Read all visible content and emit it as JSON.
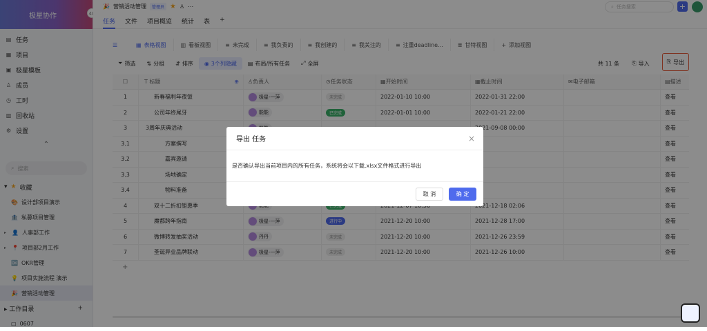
{
  "app": {
    "brand": "极星协作"
  },
  "sidebar": {
    "items": [
      {
        "label": "任务",
        "icon": "task-icon"
      },
      {
        "label": "项目",
        "icon": "folder-icon"
      },
      {
        "label": "极星模板",
        "icon": "template-icon"
      },
      {
        "label": "成员",
        "icon": "member-icon"
      },
      {
        "label": "工时",
        "icon": "clock-icon"
      },
      {
        "label": "回收站",
        "icon": "trash-icon"
      },
      {
        "label": "设置",
        "icon": "gear-icon"
      }
    ],
    "search_placeholder": "搜索",
    "favorites_label": "收藏",
    "favorites": [
      {
        "label": "设计部项目演示"
      },
      {
        "label": "私募项目管理"
      },
      {
        "label": "人事部工作"
      },
      {
        "label": "项目部2月工作"
      },
      {
        "label": "OKR管理"
      },
      {
        "label": "项目实施流程 演示"
      },
      {
        "label": "营销活动管理"
      }
    ],
    "work_dir_label": "工作目录",
    "work_dir_item": "0607"
  },
  "header": {
    "project_title": "营销活动管理",
    "admin_badge": "管理员",
    "tabs": [
      "任务",
      "文件",
      "项目概览",
      "统计",
      "表"
    ],
    "search_placeholder": "任务搜索"
  },
  "views": {
    "tabs": [
      "表格视图",
      "看板视图",
      "未完成",
      "我负责的",
      "我创建的",
      "我关注的",
      "注重deadline...",
      "甘特视图",
      "添加视图"
    ]
  },
  "toolbar": {
    "filter": "筛选",
    "group": "分组",
    "sort": "排序",
    "hidden_cols": "3个列隐藏",
    "layout": "布局/所有任务",
    "fullscreen": "全屏",
    "count": "共 11 条",
    "import": "导入",
    "export": "导出"
  },
  "table": {
    "headers": [
      "标题",
      "负责人",
      "任务状态",
      "开始时间",
      "截止时间",
      "电子邮箱",
      "描述"
    ],
    "rows": [
      {
        "no": "1",
        "title": "新春福利年夜饭",
        "owner": "极星-一萍",
        "status": "未完成",
        "start": "2022-01-10 10:00",
        "end": "2022-01-31 22:00",
        "desc": "查看"
      },
      {
        "no": "2",
        "title": "公司年终尾牙",
        "owner": "能能",
        "status": "已完成",
        "start": "2022-01-01 10:00",
        "end": "2022-01-21 22:00",
        "desc": "查看"
      },
      {
        "no": "3",
        "title": "3周年庆典活动",
        "owner": "能能",
        "status": "",
        "start": "",
        "end": "2021-09-08 00:00",
        "desc": "查看"
      },
      {
        "no": "3.1",
        "title": "方案撰写",
        "owner": "",
        "status": "",
        "start": "",
        "end": "",
        "desc": "查看"
      },
      {
        "no": "3.2",
        "title": "嘉宾邀请",
        "owner": "",
        "status": "",
        "start": "",
        "end": "",
        "desc": "查看"
      },
      {
        "no": "3.3",
        "title": "场地确定",
        "owner": "",
        "status": "",
        "start": "",
        "end": "",
        "desc": "查看"
      },
      {
        "no": "3.4",
        "title": "物料准备",
        "owner": "",
        "status": "",
        "start": "",
        "end": "",
        "desc": "查看"
      },
      {
        "no": "4",
        "title": "双十二折扣钜惠季",
        "owner": "能能",
        "status": "已完成",
        "start": "2021-12-07 10:56",
        "end": "2021-12-18 02:06",
        "desc": "查看"
      },
      {
        "no": "5",
        "title": "魔都跨年指南",
        "owner": "极星-一萍",
        "status": "进行中",
        "start": "2021-12-20 10:00",
        "end": "2021-12-28 17:00",
        "desc": "查看"
      },
      {
        "no": "6",
        "title": "微博转发抽奖活动",
        "owner": "丹丹",
        "status": "未完成",
        "start": "2021-12-20 10:00",
        "end": "2021-12-26 23:59",
        "desc": "查看"
      },
      {
        "no": "7",
        "title": "圣诞异业品牌联动",
        "owner": "极星-一萍",
        "status": "未完成",
        "start": "2021-12-20 10:00",
        "end": "2021-12-26 10:00",
        "desc": "查看"
      }
    ]
  },
  "dialog": {
    "title": "导出 任务",
    "message": "是否确认导出当前项目内的所有任务，系统将会以下载.xlsx文件格式进行导出",
    "cancel": "取 消",
    "ok": "确 定"
  },
  "colors": {
    "accent": "#4f6bed",
    "export_highlight": "#e85b3a"
  }
}
